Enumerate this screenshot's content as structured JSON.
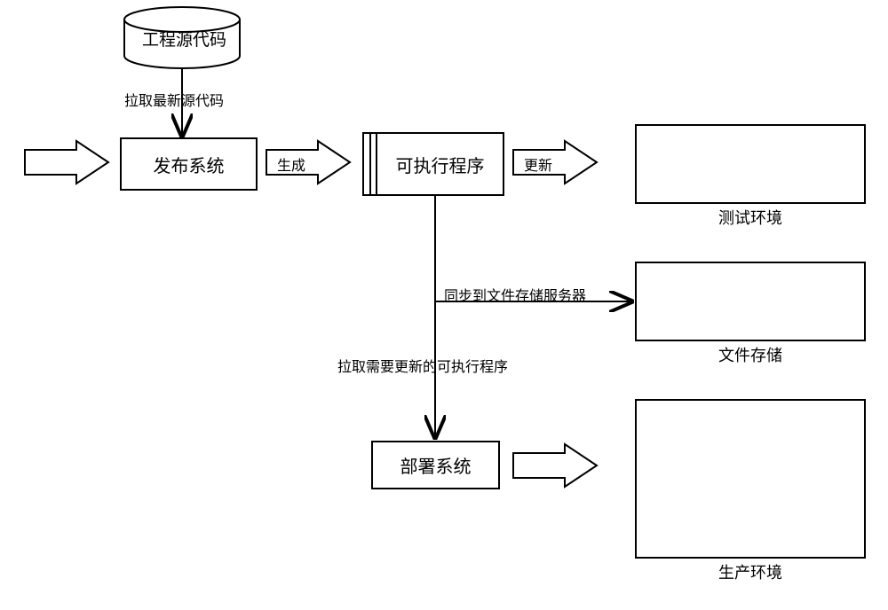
{
  "nodes": {
    "source_code": "工程源代码",
    "publish_system": "发布系统",
    "executable": "可执行程序",
    "deploy_system": "部署系统"
  },
  "edges": {
    "pull_latest_source": "拉取最新源代码",
    "generate": "生成",
    "update": "更新",
    "sync_to_file_server": "同步到文件存储服务器",
    "pull_executable_to_update": "拉取需要更新的可执行程序"
  },
  "envs": {
    "test_env": "测试环境",
    "file_storage": "文件存储",
    "prod_env": "生产环境"
  }
}
